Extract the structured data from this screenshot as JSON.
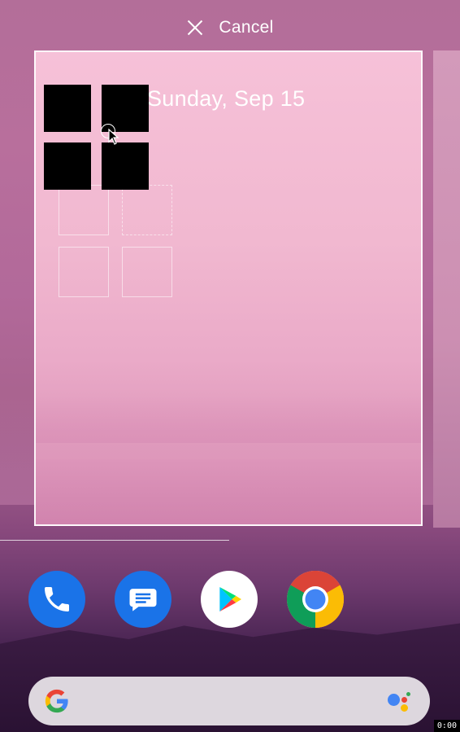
{
  "topbar": {
    "cancel_label": "Cancel",
    "cancel_icon": "close-icon"
  },
  "widget": {
    "date": "Sunday, Sep 15"
  },
  "dock": {
    "apps": [
      {
        "name": "Phone",
        "icon": "phone-icon",
        "color": "#1a73e8"
      },
      {
        "name": "Messages",
        "icon": "messages-icon",
        "color": "#1a73e8"
      },
      {
        "name": "Play Store",
        "icon": "play-store-icon",
        "color": "#ffffff"
      },
      {
        "name": "Chrome",
        "icon": "chrome-icon",
        "color": "#ffffff"
      }
    ]
  },
  "search": {
    "logo": "google-g-icon",
    "assistant": "assistant-dots-icon"
  },
  "overlay": {
    "timecode": "0:00"
  },
  "colors": {
    "accent_blue": "#1a73e8",
    "page_frame": "#ffffff"
  }
}
